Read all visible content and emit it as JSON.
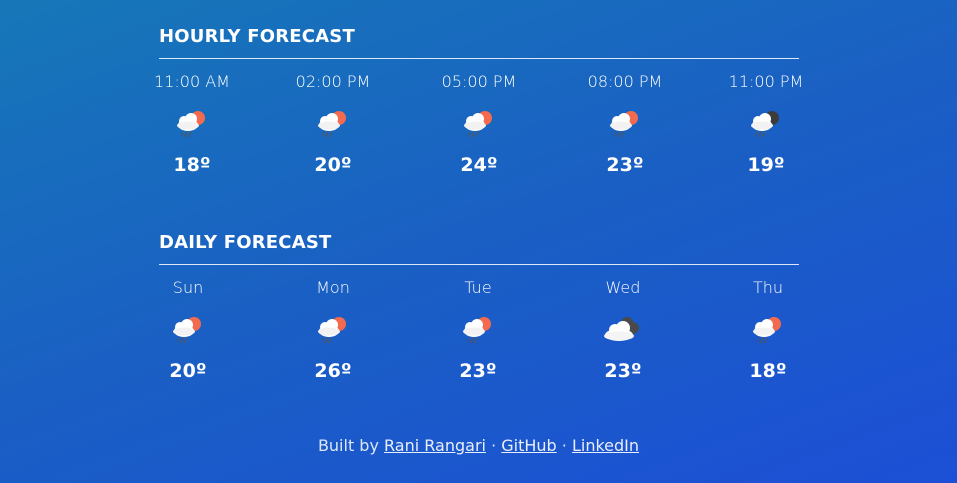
{
  "hourly": {
    "title": "HOURLY FORECAST",
    "items": [
      {
        "label": "11:00 AM",
        "icon": "partly-sunny-rain-icon",
        "temp": "18º"
      },
      {
        "label": "02:00 PM",
        "icon": "partly-sunny-rain-icon",
        "temp": "20º"
      },
      {
        "label": "05:00 PM",
        "icon": "partly-sunny-rain-icon",
        "temp": "24º"
      },
      {
        "label": "08:00 PM",
        "icon": "partly-sunny-rain-icon",
        "temp": "23º"
      },
      {
        "label": "11:00 PM",
        "icon": "night-cloud-rain-icon",
        "temp": "19º"
      }
    ]
  },
  "daily": {
    "title": "DAILY FORECAST",
    "items": [
      {
        "label": "Sun",
        "icon": "partly-sunny-rain-icon",
        "temp": "20º"
      },
      {
        "label": "Mon",
        "icon": "partly-sunny-rain-icon",
        "temp": "26º"
      },
      {
        "label": "Tue",
        "icon": "partly-sunny-rain-icon",
        "temp": "23º"
      },
      {
        "label": "Wed",
        "icon": "cloudy-icon",
        "temp": "23º"
      },
      {
        "label": "Thu",
        "icon": "partly-sunny-rain-icon",
        "temp": "18º"
      }
    ]
  },
  "footer": {
    "prefix": "Built by",
    "author": "Rani Rangari",
    "sep1": "·",
    "github": "GitHub",
    "sep2": "·",
    "linkedin": "LinkedIn"
  },
  "colors": {
    "sun": "#f26b4e",
    "cloud": "#ffffff",
    "dark_cloud": "#4a4a4a",
    "rain": "#555555"
  }
}
